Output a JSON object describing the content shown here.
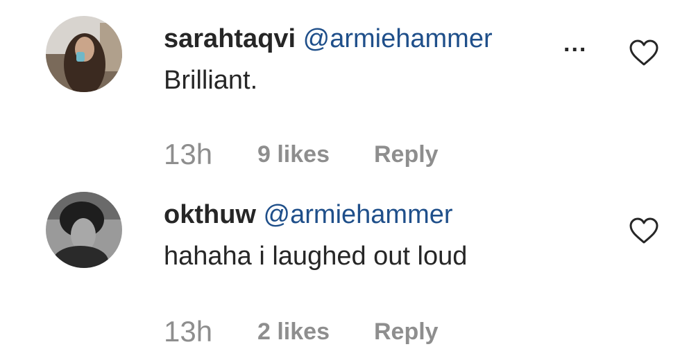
{
  "comments": [
    {
      "username": "sarahtaqvi",
      "mention": "@armiehammer",
      "more": "...",
      "text": "Brilliant.",
      "time": "13h",
      "likes": "9 likes",
      "reply": "Reply",
      "icons": {
        "avatar": "user-avatar-photo",
        "like": "heart-outline-icon"
      }
    },
    {
      "username": "okthuw",
      "mention": "@armiehammer",
      "text": "hahaha i laughed out loud",
      "time": "13h",
      "likes": "2 likes",
      "reply": "Reply",
      "icons": {
        "avatar": "user-avatar-photo",
        "like": "heart-outline-icon"
      }
    }
  ],
  "colors": {
    "username": "#262626",
    "mention": "#1f4f8a",
    "meta": "#8e8e8e"
  }
}
